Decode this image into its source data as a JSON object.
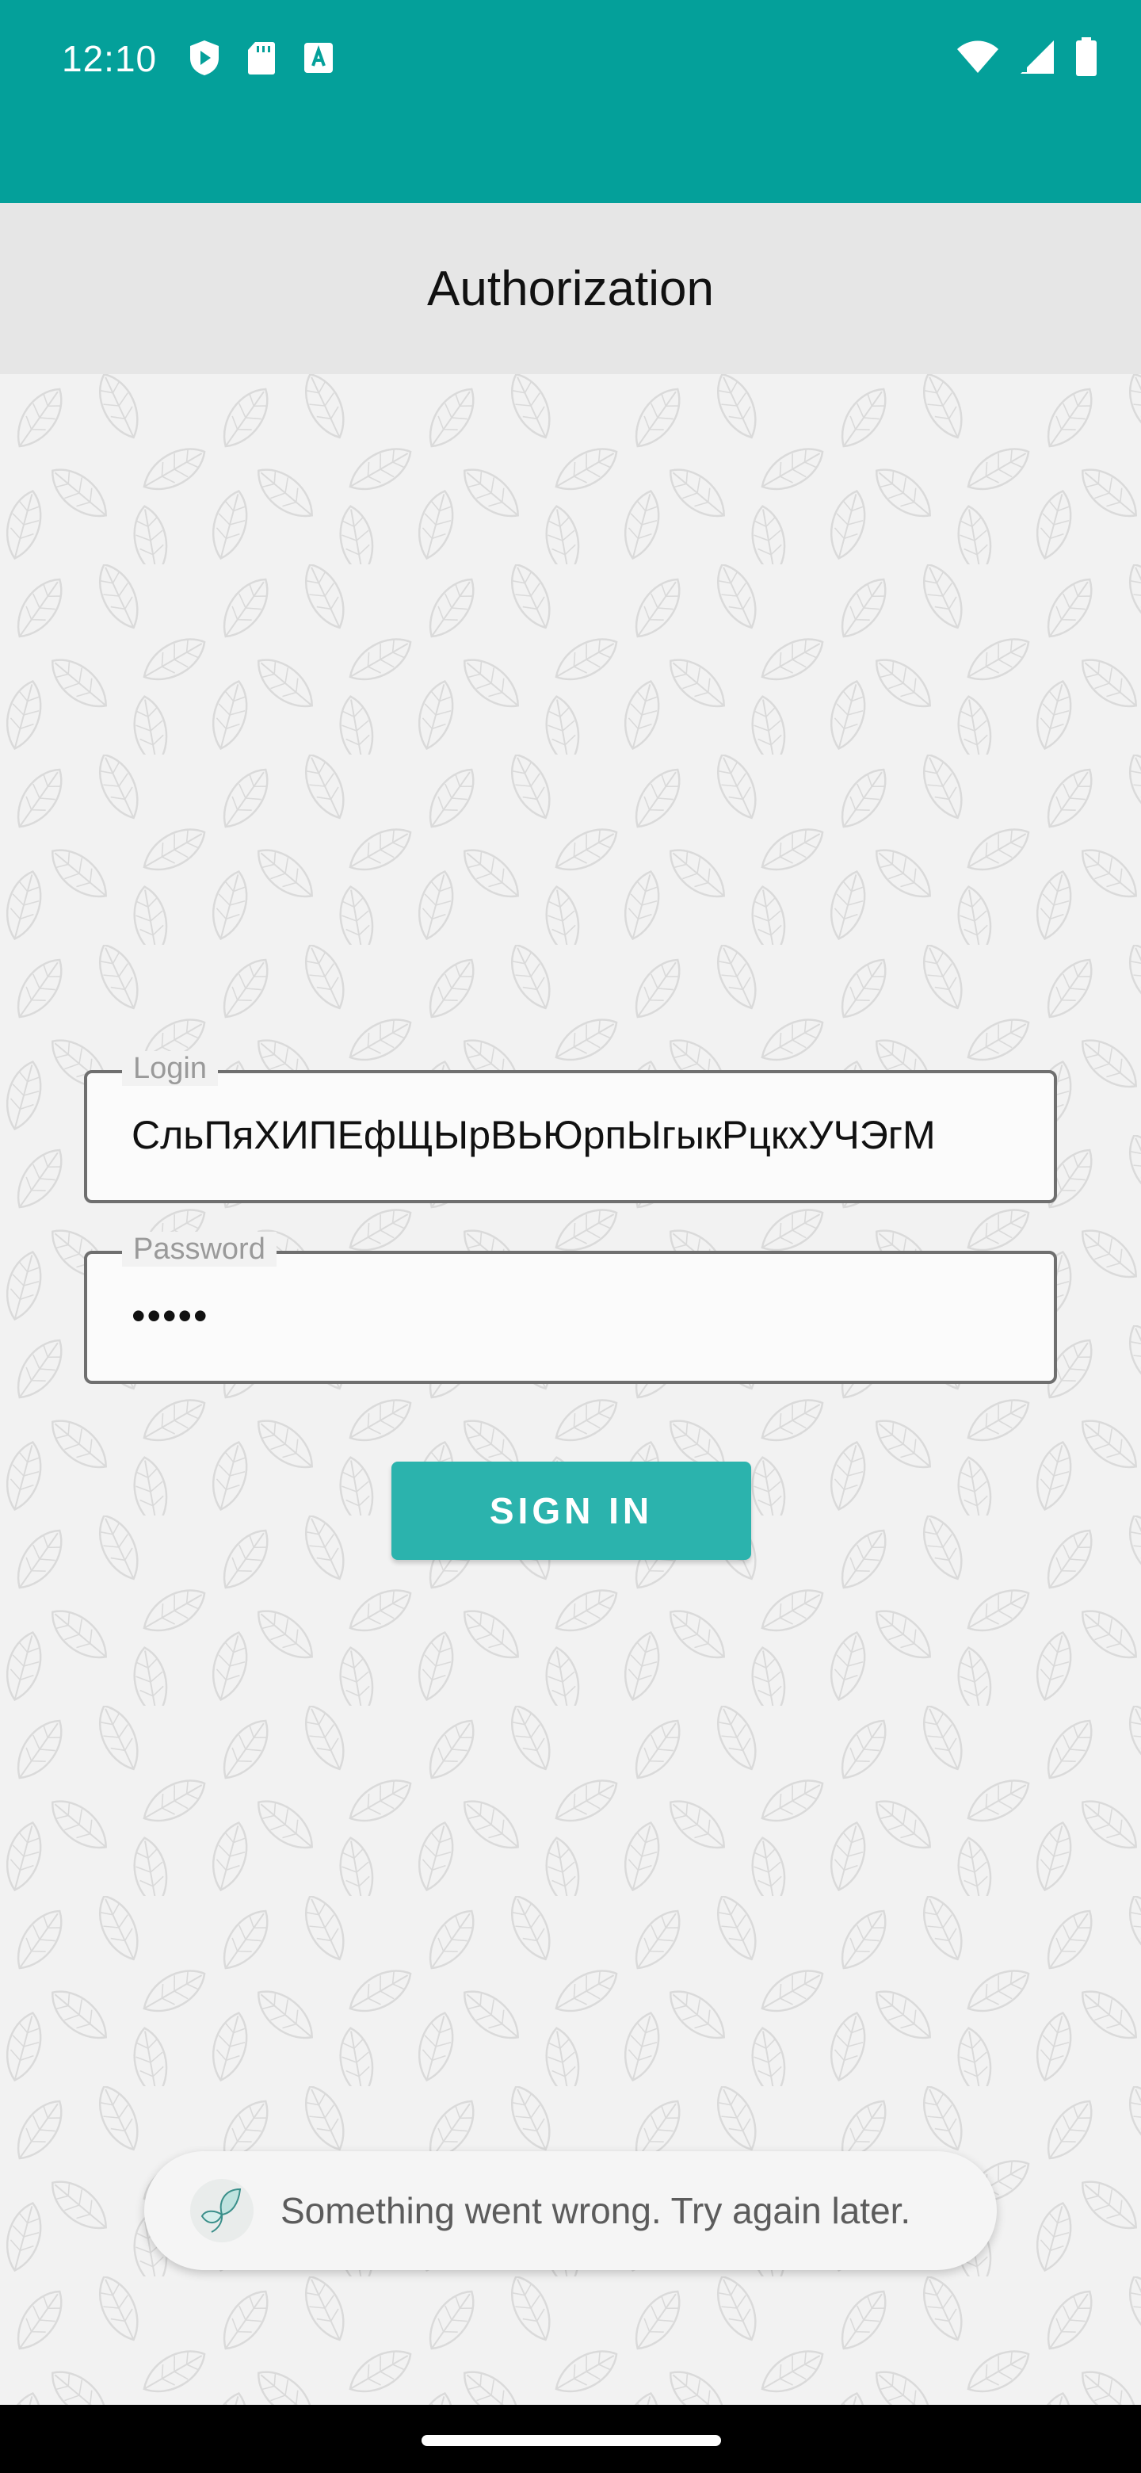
{
  "status_bar": {
    "time": "12:10",
    "left_icons": [
      "play-protect-icon",
      "sd-card-icon",
      "keyboard-a-icon"
    ],
    "right_icons": [
      "wifi-icon",
      "cell-signal-icon",
      "battery-icon"
    ],
    "background": "#04a09a"
  },
  "header": {
    "title": "Authorization"
  },
  "form": {
    "login": {
      "label": "Login",
      "value": "СльПяХИПЕфЩЫрВЬЮрпЫгыкРцкхУЧЭгМ"
    },
    "password": {
      "label": "Password",
      "value": "•••••"
    },
    "sign_in_label": "SIGN IN",
    "accent": "#2bb3ad"
  },
  "toast": {
    "icon": "butterfly-icon",
    "message": "Something went wrong. Try again later."
  }
}
